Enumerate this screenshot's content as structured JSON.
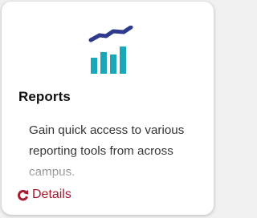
{
  "card": {
    "title": "Reports",
    "description": "Gain quick access to various reporting tools from across campus.",
    "details_label": "Details",
    "icon": "analytics-chart-icon",
    "details_icon": "rotate-arrow-icon"
  },
  "colors": {
    "chart_line": "#2e3a8c",
    "chart_bars": "#1aa7b8",
    "details_accent": "#a6192e",
    "card_background": "#ffffff",
    "page_background": "#f1f1f1"
  }
}
